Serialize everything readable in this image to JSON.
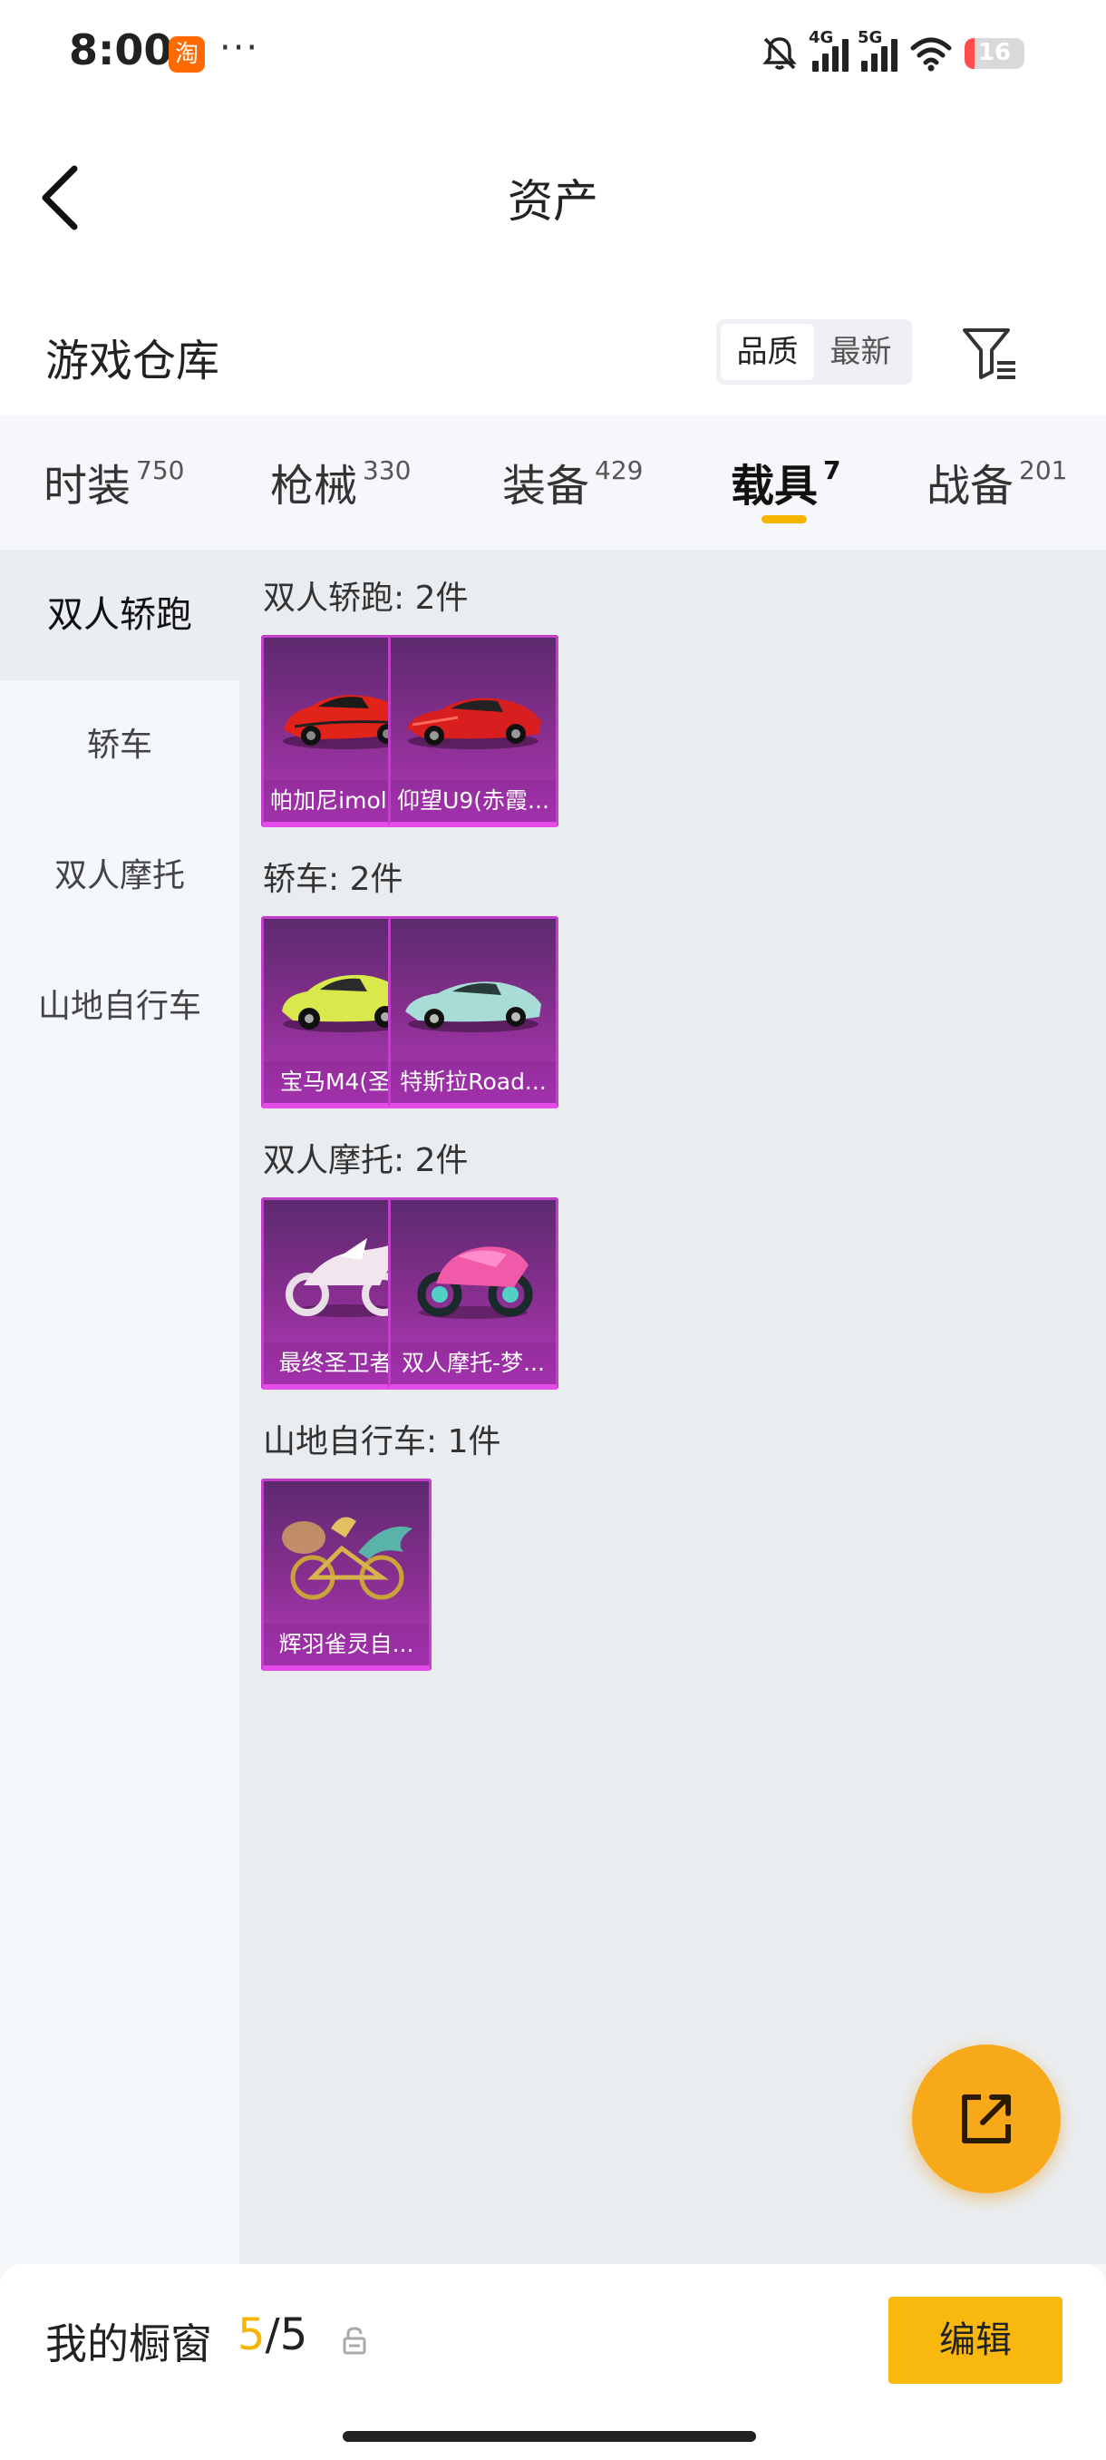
{
  "status_bar": {
    "time": "8:00",
    "app_badge": "淘",
    "more": "···",
    "network_1": "4G",
    "network_2": "5G",
    "battery": "16"
  },
  "header": {
    "title": "资产"
  },
  "warehouse": {
    "title": "游戏仓库",
    "sort_options": [
      "品质",
      "最新"
    ],
    "active_sort": "品质"
  },
  "tabs": [
    {
      "label": "时装",
      "count": "750"
    },
    {
      "label": "枪械",
      "count": "330"
    },
    {
      "label": "装备",
      "count": "429"
    },
    {
      "label": "载具",
      "count": "7"
    },
    {
      "label": "战备",
      "count": "201"
    }
  ],
  "active_tab": "载具",
  "sidebar": {
    "items": [
      "双人轿跑",
      "轿车",
      "双人摩托",
      "山地自行车"
    ],
    "active": "双人轿跑"
  },
  "groups": [
    {
      "title": "双人轿跑: 2件",
      "items": [
        {
          "name": "帕加尼imola...",
          "icon": "red-supercar-icon"
        },
        {
          "name": "仰望U9(赤霞...",
          "icon": "red-sportscar-icon"
        }
      ]
    },
    {
      "title": "轿车: 2件",
      "items": [
        {
          "name": "宝马M4(圣...",
          "icon": "yellow-sedan-icon"
        },
        {
          "name": "特斯拉Road...",
          "icon": "teal-roadster-icon"
        }
      ]
    },
    {
      "title": "双人摩托: 2件",
      "items": [
        {
          "name": "最终圣卫者...",
          "icon": "white-motorcycle-icon"
        },
        {
          "name": "双人摩托-梦...",
          "icon": "pink-motorcycle-icon"
        }
      ]
    },
    {
      "title": "山地自行车: 1件",
      "items": [
        {
          "name": "辉羽雀灵自...",
          "icon": "golden-bicycle-icon"
        }
      ]
    }
  ],
  "showcase": {
    "label": "我的橱窗",
    "current": "5",
    "separator": "/",
    "total": "5",
    "edit_label": "编辑"
  },
  "colors": {
    "accent": "#f7b500",
    "card_purple": "#8a2f92",
    "fab": "#f8a91a"
  }
}
